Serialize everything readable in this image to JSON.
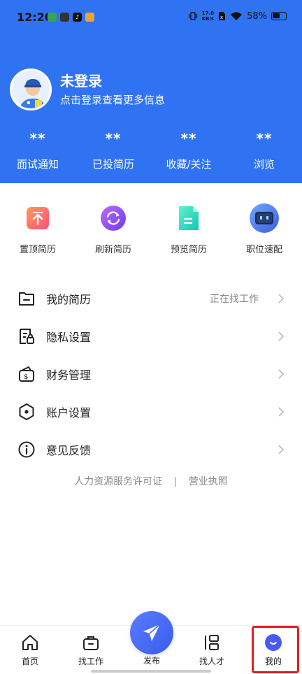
{
  "status_bar": {
    "time": "12:20",
    "net_speed_value": "17.0",
    "net_speed_unit": "KB/s",
    "battery": "58%"
  },
  "profile": {
    "name": "未登录",
    "subtitle": "点击登录查看更多信息"
  },
  "stats": [
    {
      "value": "**",
      "label": "面试通知"
    },
    {
      "value": "**",
      "label": "已投简历"
    },
    {
      "value": "**",
      "label": "收藏/关注"
    },
    {
      "value": "**",
      "label": "浏览"
    }
  ],
  "quick_actions": [
    {
      "label": "置顶简历",
      "icon": "pin-top-icon"
    },
    {
      "label": "刷新简历",
      "icon": "refresh-icon"
    },
    {
      "label": "预览简历",
      "icon": "document-icon"
    },
    {
      "label": "职位速配",
      "icon": "robot-icon"
    }
  ],
  "menu": [
    {
      "label": "我的简历",
      "status": "正在找工作",
      "icon": "folder-icon"
    },
    {
      "label": "隐私设置",
      "status": "",
      "icon": "lock-document-icon"
    },
    {
      "label": "财务管理",
      "status": "",
      "icon": "wallet-icon"
    },
    {
      "label": "账户设置",
      "status": "",
      "icon": "hexagon-settings-icon"
    },
    {
      "label": "意见反馈",
      "status": "",
      "icon": "info-icon"
    }
  ],
  "license": {
    "hr_license": "人力资源服务许可证",
    "separator": "|",
    "business_license": "营业执照"
  },
  "bottom_nav": {
    "home": "首页",
    "find_job": "找工作",
    "publish": "发布",
    "find_talent": "找人才",
    "mine": "我的"
  },
  "colors": {
    "brand_blue": "#2f73f3",
    "highlight_red": "#e02020"
  }
}
